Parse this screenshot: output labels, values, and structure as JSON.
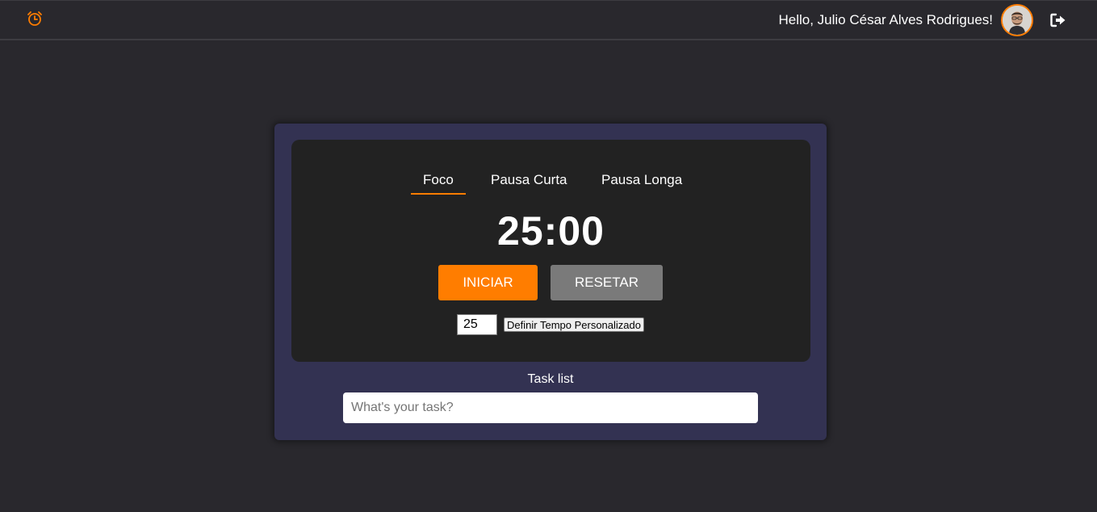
{
  "header": {
    "greeting": "Hello, Julio César Alves Rodrigues!",
    "logo_icon": "alarm-clock-icon",
    "avatar_icon": "user-avatar",
    "logout_icon": "sign-out-icon",
    "accent_color": "#ff7d00"
  },
  "timer": {
    "tabs": [
      {
        "label": "Foco",
        "active": true
      },
      {
        "label": "Pausa Curta",
        "active": false
      },
      {
        "label": "Pausa Longa",
        "active": false
      }
    ],
    "time": "25:00",
    "start_label": "INICIAR",
    "reset_label": "RESETAR",
    "custom_value": "25",
    "custom_button_label": "Definir Tempo Personalizado"
  },
  "tasks": {
    "title": "Task list",
    "placeholder": "What's your task?"
  }
}
